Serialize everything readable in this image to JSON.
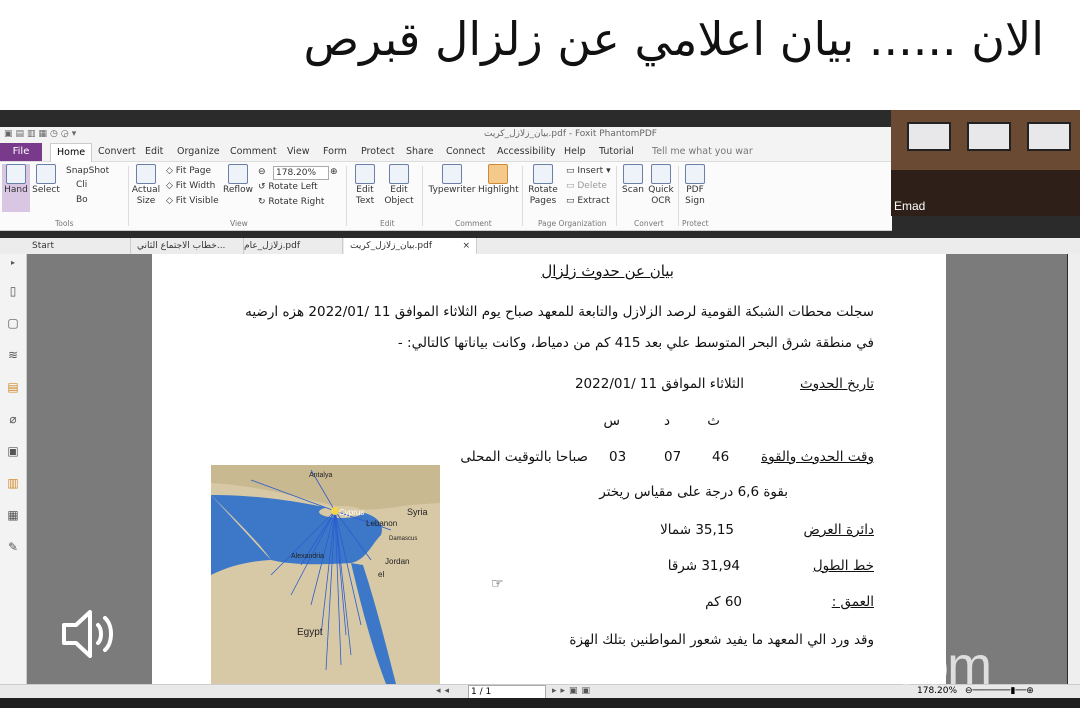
{
  "banner": {
    "title": "الان ...... بيان اعلامي عن  زلزال قبرص"
  },
  "app": {
    "window_title": "بيان_زلازل_كريت.pdf - Foxit PhantomPDF",
    "menu": [
      "File",
      "Home",
      "Convert",
      "Edit",
      "Organize",
      "Comment",
      "View",
      "Form",
      "Protect",
      "Share",
      "Connect",
      "Accessibility",
      "Help",
      "Tutorial",
      "Tell me what you war"
    ],
    "ribbon": {
      "hand": "Hand",
      "select": "Select",
      "snapshot": "SnapShot",
      "clipboard": "Cli",
      "bookmark": "Bo",
      "actual_size": "Actual Size",
      "fit_page": "Fit Page",
      "fit_width": "Fit Width",
      "fit_visible": "Fit Visible",
      "reflow": "Reflow",
      "zoom": "178.20%",
      "rotate_left": "Rotate Left",
      "rotate_right": "Rotate Right",
      "edit_text": "Edit Text",
      "edit_object": "Edit Object",
      "typewriter": "Typewriter",
      "highlight": "Highlight",
      "rotate_pages": "Rotate Pages",
      "insert": "Insert",
      "delete": "Delete",
      "extract": "Extract",
      "scan": "Scan",
      "quick_ocr": "Quick OCR",
      "pdf_sign": "PDF Sign",
      "groups": {
        "tools": "Tools",
        "view": "View",
        "edit": "Edit",
        "comment": "Comment",
        "page_org": "Page Organization",
        "convert": "Convert",
        "protect": "Protect"
      }
    },
    "tabs": [
      "Start",
      "خطاب الاجتماع الثاني...",
      "زلازل_عام.pdf",
      "بيان_زلازل_كريت.pdf"
    ],
    "status": {
      "page": "1 / 1",
      "zoom": "178.20%"
    }
  },
  "document": {
    "heading": "بيان عن حدوث زلزال",
    "para1": "سجلت محطات الشبكة القومية لرصد الزلازل والتابعة للمعهد صباح يوم الثلاثاء  الموافق 11 /2022/01 هزه ارضيه",
    "para2": "في منطقة شرق البحر المتوسط علي بعد 415 كم من دمياط، وكانت بياناتها كالتالي: -",
    "date_label": "تاريخ الحدوث",
    "date_value": "الثلاثاء  الموافق 11 /2022/01",
    "h_label": "ث",
    "m_label": "د",
    "s_label": "س",
    "time_label": "وقت الحدوث والقوة",
    "sec": "46",
    "min": "07",
    "hour": "03",
    "time_note": "صباحا بالتوقيت المحلى",
    "magnitude": "بقوة 6,6 درجة على مقياس ريختر",
    "lat_label": "دائرة العرض",
    "lat_value": "35,15 شمالا",
    "lon_label": "خط الطول",
    "lon_value": "31,94  شرقا",
    "depth_label": "العمق :",
    "depth_value": "60 كم",
    "closing": "وقد ورد الي المعهد ما يفيد شعور المواطنين بتلك الهزة",
    "map_labels": {
      "cyprus": "Cyprus",
      "syria": "Syria",
      "lebanon": "Lebanon",
      "jordan": "Jordan",
      "egypt": "Egypt",
      "antalya": "Antalya",
      "alexandria": "Alexandria",
      "damascus": "Damascus",
      "israel": "el"
    }
  },
  "video": {
    "participant": "Emad",
    "watermark": "zoom"
  }
}
